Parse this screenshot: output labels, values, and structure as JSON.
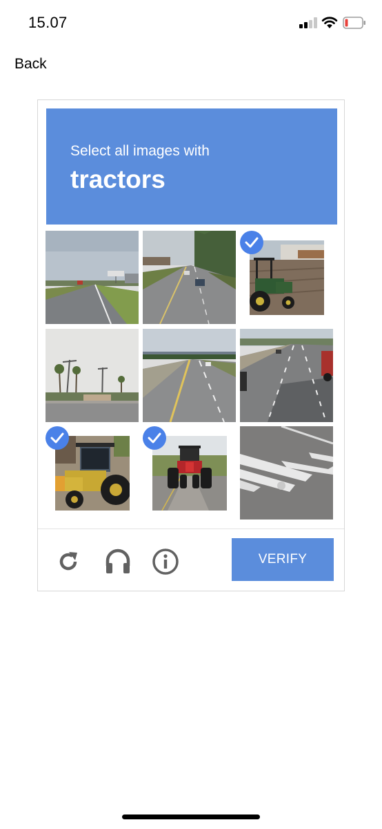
{
  "status_bar": {
    "time": "15.07",
    "icons": [
      "signal-icon",
      "wifi-icon",
      "battery-low-icon"
    ],
    "battery_color": "#e8403a"
  },
  "nav": {
    "back_label": "Back"
  },
  "captcha": {
    "instruction": "Select all images with",
    "target": "tractors",
    "accent_color": "#5b8ddc",
    "check_color": "#4a81e8",
    "tiles": [
      {
        "row": 1,
        "col": 1,
        "selected": false
      },
      {
        "row": 1,
        "col": 2,
        "selected": false
      },
      {
        "row": 1,
        "col": 3,
        "selected": true
      },
      {
        "row": 2,
        "col": 1,
        "selected": false
      },
      {
        "row": 2,
        "col": 2,
        "selected": false
      },
      {
        "row": 2,
        "col": 3,
        "selected": false
      },
      {
        "row": 3,
        "col": 1,
        "selected": true
      },
      {
        "row": 3,
        "col": 2,
        "selected": true
      },
      {
        "row": 3,
        "col": 3,
        "selected": false
      }
    ],
    "controls": [
      "reload-icon",
      "headphones-icon",
      "info-icon"
    ],
    "verify_label": "VERIFY"
  }
}
